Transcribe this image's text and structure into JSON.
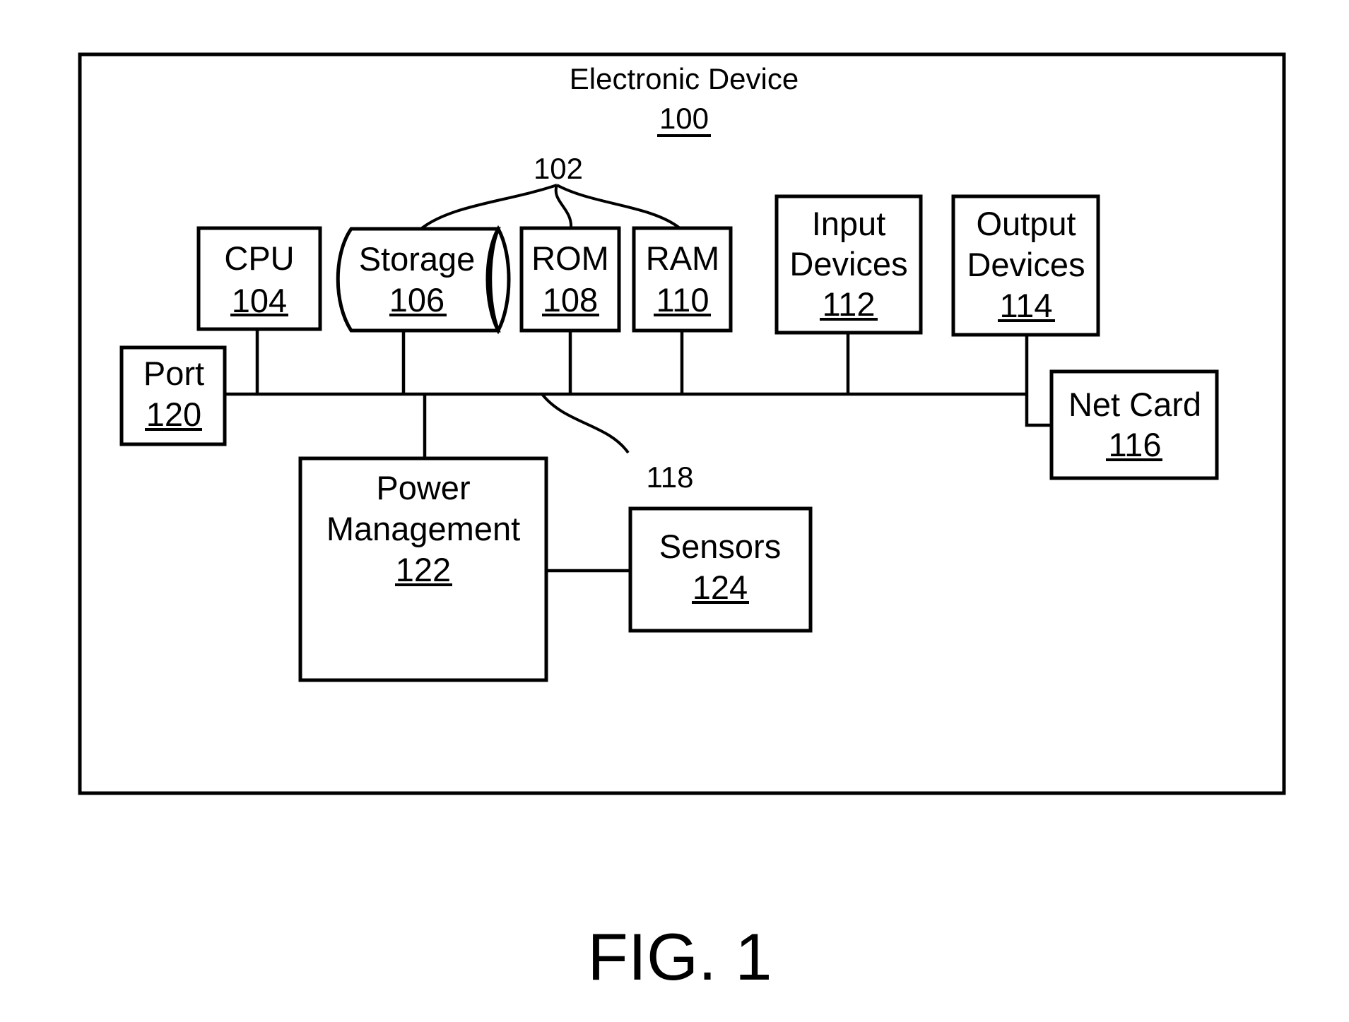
{
  "figure": {
    "caption": "FIG. 1",
    "container": {
      "name": "Electronic Device",
      "ref": "100"
    },
    "memory_group_ref": "102",
    "bus_ref": "118",
    "components": {
      "cpu": {
        "lines": [
          "CPU"
        ],
        "ref": "104"
      },
      "storage": {
        "lines": [
          "Storage"
        ],
        "ref": "106"
      },
      "rom": {
        "lines": [
          "ROM"
        ],
        "ref": "108"
      },
      "ram": {
        "lines": [
          "RAM"
        ],
        "ref": "110"
      },
      "input": {
        "lines": [
          "Input",
          "Devices"
        ],
        "ref": "112"
      },
      "output": {
        "lines": [
          "Output",
          "Devices"
        ],
        "ref": "114"
      },
      "netcard": {
        "lines": [
          "Net Card"
        ],
        "ref": "116"
      },
      "port": {
        "lines": [
          "Port"
        ],
        "ref": "120"
      },
      "power": {
        "lines": [
          "Power",
          "Management"
        ],
        "ref": "122"
      },
      "sensors": {
        "lines": [
          "Sensors"
        ],
        "ref": "124"
      }
    },
    "connections": [
      [
        "port",
        "bus"
      ],
      [
        "cpu",
        "bus"
      ],
      [
        "storage",
        "bus"
      ],
      [
        "rom",
        "bus"
      ],
      [
        "ram",
        "bus"
      ],
      [
        "input",
        "bus"
      ],
      [
        "output",
        "bus"
      ],
      [
        "netcard",
        "bus"
      ],
      [
        "power",
        "bus"
      ],
      [
        "power",
        "sensors"
      ]
    ]
  }
}
